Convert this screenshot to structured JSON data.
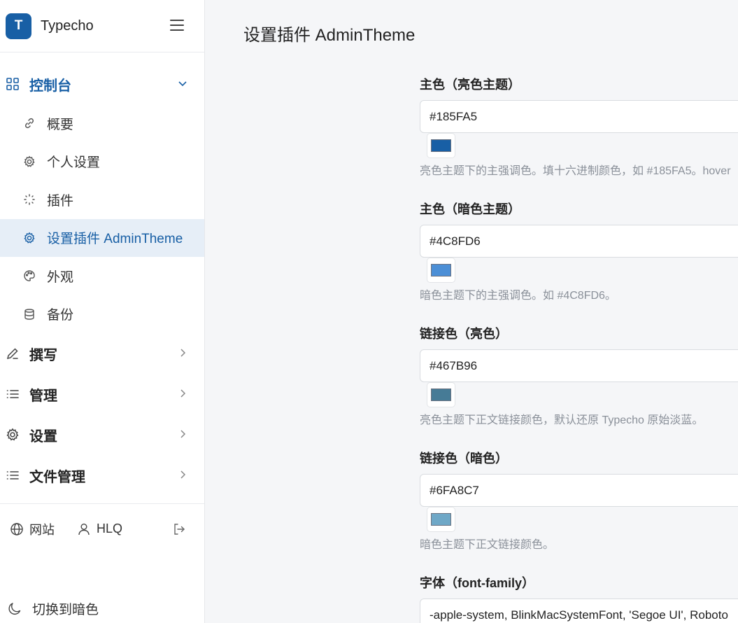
{
  "brand": {
    "logo_letter": "T",
    "name": "Typecho"
  },
  "sidebar": {
    "groups": [
      {
        "label": "控制台",
        "icon": "grid-icon",
        "expanded": true
      },
      {
        "label": "撰写",
        "icon": "pencil-icon"
      },
      {
        "label": "管理",
        "icon": "list-icon"
      },
      {
        "label": "设置",
        "icon": "gear-icon"
      },
      {
        "label": "文件管理",
        "icon": "list-icon"
      }
    ],
    "subitems": [
      {
        "label": "概要",
        "icon": "link-icon"
      },
      {
        "label": "个人设置",
        "icon": "gear-icon"
      },
      {
        "label": "插件",
        "icon": "plugin-icon"
      },
      {
        "label": "设置插件 AdminTheme",
        "icon": "gear-icon",
        "selected": true
      },
      {
        "label": "外观",
        "icon": "palette-icon"
      },
      {
        "label": "备份",
        "icon": "database-icon"
      }
    ]
  },
  "footer": {
    "site_label": "网站",
    "user_label": "HLQ",
    "theme_switch_label": "切换到暗色"
  },
  "page": {
    "title": "设置插件 AdminTheme"
  },
  "fields": [
    {
      "label": "主色（亮色主题）",
      "value": "#185FA5",
      "swatch": "#185FA5",
      "desc": "亮色主题下的主强调色。填十六进制颜色，如 #185FA5。hover"
    },
    {
      "label": "主色（暗色主题）",
      "value": "#4C8FD6",
      "swatch": "#4C8FD6",
      "desc": "暗色主题下的主强调色。如 #4C8FD6。"
    },
    {
      "label": "链接色（亮色）",
      "value": "#467B96",
      "swatch": "#467B96",
      "desc": "亮色主题下正文链接颜色，默认还原 Typecho 原始淡蓝。"
    },
    {
      "label": "链接色（暗色）",
      "value": "#6FA8C7",
      "swatch": "#6FA8C7",
      "desc": "暗色主题下正文链接颜色。"
    },
    {
      "label": "字体（font-family）",
      "value": "-apple-system, BlinkMacSystemFont, 'Segoe UI', Roboto"
    }
  ],
  "colors": {
    "accent": "#185FA5",
    "selected_bg": "#E6EEF7"
  }
}
